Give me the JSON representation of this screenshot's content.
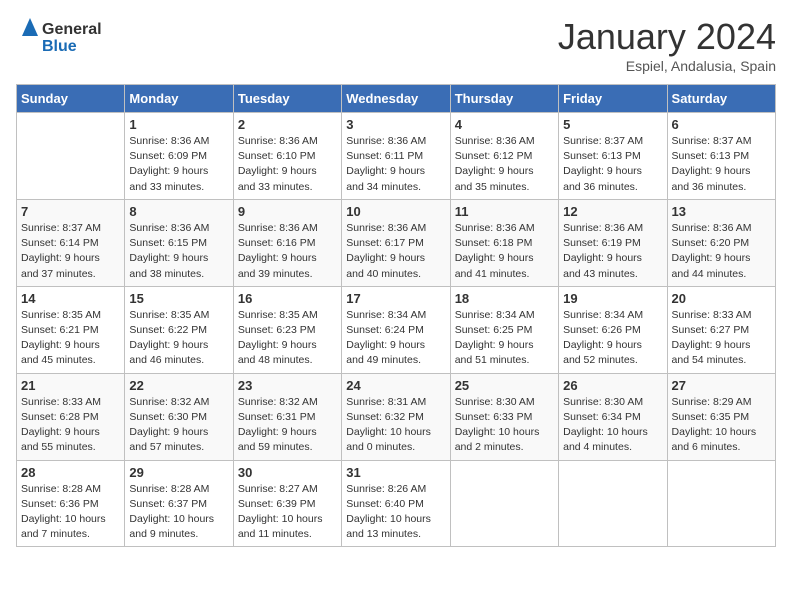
{
  "header": {
    "logo_general": "General",
    "logo_blue": "Blue",
    "month": "January 2024",
    "location": "Espiel, Andalusia, Spain"
  },
  "weekdays": [
    "Sunday",
    "Monday",
    "Tuesday",
    "Wednesday",
    "Thursday",
    "Friday",
    "Saturday"
  ],
  "weeks": [
    [
      {
        "day": "",
        "info": ""
      },
      {
        "day": "1",
        "info": "Sunrise: 8:36 AM\nSunset: 6:09 PM\nDaylight: 9 hours\nand 33 minutes."
      },
      {
        "day": "2",
        "info": "Sunrise: 8:36 AM\nSunset: 6:10 PM\nDaylight: 9 hours\nand 33 minutes."
      },
      {
        "day": "3",
        "info": "Sunrise: 8:36 AM\nSunset: 6:11 PM\nDaylight: 9 hours\nand 34 minutes."
      },
      {
        "day": "4",
        "info": "Sunrise: 8:36 AM\nSunset: 6:12 PM\nDaylight: 9 hours\nand 35 minutes."
      },
      {
        "day": "5",
        "info": "Sunrise: 8:37 AM\nSunset: 6:13 PM\nDaylight: 9 hours\nand 36 minutes."
      },
      {
        "day": "6",
        "info": "Sunrise: 8:37 AM\nSunset: 6:13 PM\nDaylight: 9 hours\nand 36 minutes."
      }
    ],
    [
      {
        "day": "7",
        "info": "Sunrise: 8:37 AM\nSunset: 6:14 PM\nDaylight: 9 hours\nand 37 minutes."
      },
      {
        "day": "8",
        "info": "Sunrise: 8:36 AM\nSunset: 6:15 PM\nDaylight: 9 hours\nand 38 minutes."
      },
      {
        "day": "9",
        "info": "Sunrise: 8:36 AM\nSunset: 6:16 PM\nDaylight: 9 hours\nand 39 minutes."
      },
      {
        "day": "10",
        "info": "Sunrise: 8:36 AM\nSunset: 6:17 PM\nDaylight: 9 hours\nand 40 minutes."
      },
      {
        "day": "11",
        "info": "Sunrise: 8:36 AM\nSunset: 6:18 PM\nDaylight: 9 hours\nand 41 minutes."
      },
      {
        "day": "12",
        "info": "Sunrise: 8:36 AM\nSunset: 6:19 PM\nDaylight: 9 hours\nand 43 minutes."
      },
      {
        "day": "13",
        "info": "Sunrise: 8:36 AM\nSunset: 6:20 PM\nDaylight: 9 hours\nand 44 minutes."
      }
    ],
    [
      {
        "day": "14",
        "info": "Sunrise: 8:35 AM\nSunset: 6:21 PM\nDaylight: 9 hours\nand 45 minutes."
      },
      {
        "day": "15",
        "info": "Sunrise: 8:35 AM\nSunset: 6:22 PM\nDaylight: 9 hours\nand 46 minutes."
      },
      {
        "day": "16",
        "info": "Sunrise: 8:35 AM\nSunset: 6:23 PM\nDaylight: 9 hours\nand 48 minutes."
      },
      {
        "day": "17",
        "info": "Sunrise: 8:34 AM\nSunset: 6:24 PM\nDaylight: 9 hours\nand 49 minutes."
      },
      {
        "day": "18",
        "info": "Sunrise: 8:34 AM\nSunset: 6:25 PM\nDaylight: 9 hours\nand 51 minutes."
      },
      {
        "day": "19",
        "info": "Sunrise: 8:34 AM\nSunset: 6:26 PM\nDaylight: 9 hours\nand 52 minutes."
      },
      {
        "day": "20",
        "info": "Sunrise: 8:33 AM\nSunset: 6:27 PM\nDaylight: 9 hours\nand 54 minutes."
      }
    ],
    [
      {
        "day": "21",
        "info": "Sunrise: 8:33 AM\nSunset: 6:28 PM\nDaylight: 9 hours\nand 55 minutes."
      },
      {
        "day": "22",
        "info": "Sunrise: 8:32 AM\nSunset: 6:30 PM\nDaylight: 9 hours\nand 57 minutes."
      },
      {
        "day": "23",
        "info": "Sunrise: 8:32 AM\nSunset: 6:31 PM\nDaylight: 9 hours\nand 59 minutes."
      },
      {
        "day": "24",
        "info": "Sunrise: 8:31 AM\nSunset: 6:32 PM\nDaylight: 10 hours\nand 0 minutes."
      },
      {
        "day": "25",
        "info": "Sunrise: 8:30 AM\nSunset: 6:33 PM\nDaylight: 10 hours\nand 2 minutes."
      },
      {
        "day": "26",
        "info": "Sunrise: 8:30 AM\nSunset: 6:34 PM\nDaylight: 10 hours\nand 4 minutes."
      },
      {
        "day": "27",
        "info": "Sunrise: 8:29 AM\nSunset: 6:35 PM\nDaylight: 10 hours\nand 6 minutes."
      }
    ],
    [
      {
        "day": "28",
        "info": "Sunrise: 8:28 AM\nSunset: 6:36 PM\nDaylight: 10 hours\nand 7 minutes."
      },
      {
        "day": "29",
        "info": "Sunrise: 8:28 AM\nSunset: 6:37 PM\nDaylight: 10 hours\nand 9 minutes."
      },
      {
        "day": "30",
        "info": "Sunrise: 8:27 AM\nSunset: 6:39 PM\nDaylight: 10 hours\nand 11 minutes."
      },
      {
        "day": "31",
        "info": "Sunrise: 8:26 AM\nSunset: 6:40 PM\nDaylight: 10 hours\nand 13 minutes."
      },
      {
        "day": "",
        "info": ""
      },
      {
        "day": "",
        "info": ""
      },
      {
        "day": "",
        "info": ""
      }
    ]
  ]
}
